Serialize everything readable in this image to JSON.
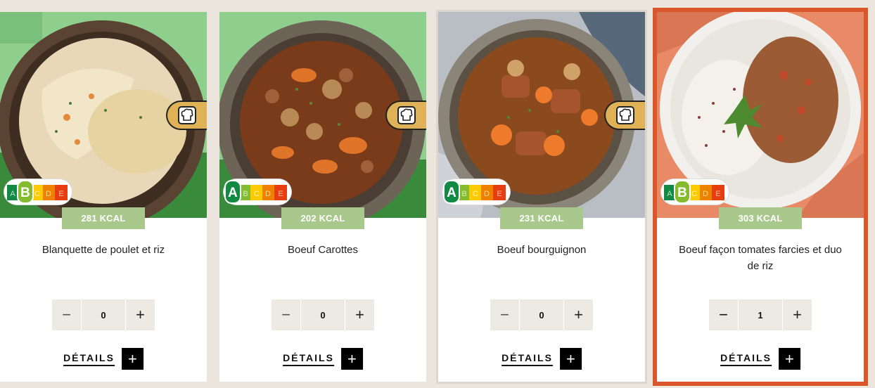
{
  "products": [
    {
      "kcal": "281 KCAL",
      "name": "Blanquette de poulet et riz",
      "quantity": "0",
      "details_label": "DÉTAILS",
      "nutriscore": "B",
      "chef_badge": true,
      "selected": false
    },
    {
      "kcal": "202 KCAL",
      "name": "Boeuf Carottes",
      "quantity": "0",
      "details_label": "DÉTAILS",
      "nutriscore": "A",
      "chef_badge": true,
      "selected": false
    },
    {
      "kcal": "231 KCAL",
      "name": "Boeuf bourguignon",
      "quantity": "0",
      "details_label": "DÉTAILS",
      "nutriscore": "A",
      "chef_badge": true,
      "selected": false
    },
    {
      "kcal": "303 KCAL",
      "name": "Boeuf façon tomates farcies et duo de riz",
      "quantity": "1",
      "details_label": "DÉTAILS",
      "nutriscore": "B",
      "chef_badge": false,
      "selected": true
    }
  ],
  "stepper": {
    "minus": "−",
    "plus": "+"
  },
  "details_icon": "+",
  "nutriscore_letters": [
    "A",
    "B",
    "C",
    "D",
    "E"
  ],
  "icons": {
    "chef": "chef-hat-icon",
    "nutriscore": "nutriscore-badge-icon"
  },
  "colors": {
    "kcal_badge": "#a9c88b",
    "selected_border": "#d9572a",
    "chef_badge": "#e0b257",
    "background": "#ebe5dd"
  }
}
